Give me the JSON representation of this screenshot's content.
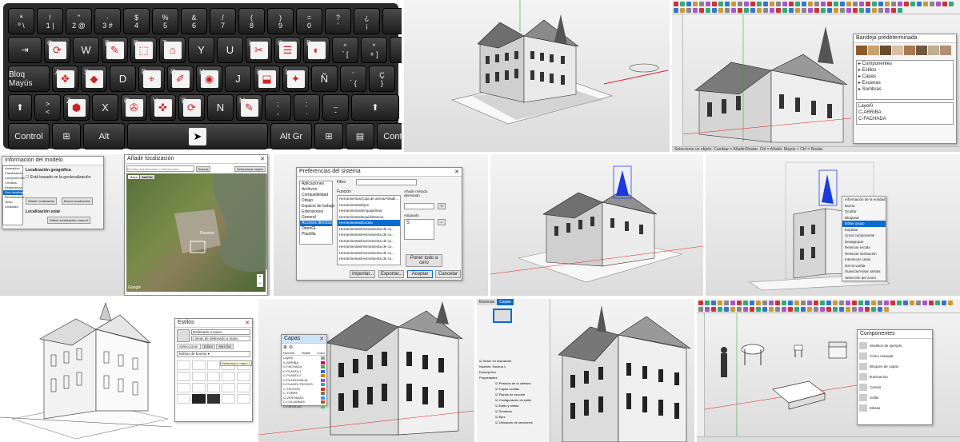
{
  "keyboard": {
    "row1": [
      {
        "top": "ª",
        "bottom": "º \\"
      },
      {
        "top": "!",
        "bottom": "1 |"
      },
      {
        "top": "\"",
        "bottom": "2 @"
      },
      {
        "top": "·",
        "bottom": "3 #"
      },
      {
        "top": "$",
        "bottom": "4"
      },
      {
        "top": "%",
        "bottom": "5"
      },
      {
        "top": "&",
        "bottom": "6"
      },
      {
        "top": "/",
        "bottom": "7"
      },
      {
        "top": "(",
        "bottom": "8"
      },
      {
        "top": ")",
        "bottom": "9"
      },
      {
        "top": "=",
        "bottom": "0"
      },
      {
        "top": "?",
        "bottom": "'"
      },
      {
        "top": "¿",
        "bottom": "¡"
      }
    ],
    "backspace": "←",
    "tab": "⇥",
    "row2_letters": [
      "Q",
      "W",
      "E",
      "R",
      "T",
      "Y",
      "U",
      "I",
      "O",
      "P"
    ],
    "row2_extra": [
      {
        "top": "^",
        "bottom": "` ["
      },
      {
        "top": "*",
        "bottom": "+ ]"
      }
    ],
    "enter": "↵",
    "caps": "Bloq Mayús",
    "row3_letters": [
      "A",
      "S",
      "D",
      "F",
      "G",
      "H",
      "J",
      "K",
      "L",
      "Ñ"
    ],
    "row3_extra": [
      {
        "top": "¨",
        "bottom": "´ {"
      },
      {
        "top": "Ç",
        "bottom": "}"
      }
    ],
    "shift_left": "⬆",
    "angle": {
      "top": ">",
      "bottom": "<"
    },
    "row4_letters": [
      "Z",
      "X",
      "C",
      "V",
      "B",
      "N",
      "M"
    ],
    "row4_extra": [
      {
        "top": ";",
        "bottom": ","
      },
      {
        "top": ":",
        "bottom": "."
      },
      {
        "top": "_",
        "bottom": "-"
      }
    ],
    "shift_right": "⬆",
    "control_left": "Control",
    "alt": "Alt",
    "altgr": "Alt Gr",
    "control_right": "Control"
  },
  "geo_dialog": {
    "title": "Información del modelo",
    "section": "Localización geográfica",
    "checkbox": "Está basado en la geolocalización",
    "side_items": [
      "Animación",
      "Clasificación",
      "Componentes",
      "Créditos",
      "Estadísticas",
      "Geo-localización",
      "Renderización",
      "Texto",
      "Unidades"
    ],
    "selected_side": "Geo-localización",
    "button1": "Añadir localización",
    "button2": "Borrar localización",
    "sun_title": "Localización solar",
    "sun_button": "Definir localización manual"
  },
  "map_window": {
    "title": "Añadir localización",
    "search_placeholder": "Escriba una dirección o intersección",
    "search_button": "Buscar",
    "select_region": "Seleccionar región",
    "tab_map": "Mapa",
    "tab_satellite": "Satélite",
    "city_label": "Rosario",
    "footer": "Google"
  },
  "prefs": {
    "title": "Preferencias del sistema",
    "categories": [
      "Aplicaciones",
      "Archivos",
      "Compatibilidad",
      "Dibujo",
      "Espacio de trabajo",
      "Extensiones",
      "General",
      "OpenGL",
      "Plantilla"
    ],
    "selected_category": "Accesos directos",
    "filter_label": "Filtro",
    "function_label": "Función",
    "functions": [
      "Herramientas/Caja de arena/Añadir...",
      "Herramientas/Ejes",
      "Herramientas/Empujar/tirar",
      "Herramientas/Equidistancia",
      "Herramientas/Escala",
      "Herramientas/Herramienta de co...",
      "Herramientas/Herramienta de co...",
      "Herramientas/Herramienta de co...",
      "Herramientas/Herramienta de co...",
      "Herramientas/Herramienta de co...",
      "Herramientas/Herramienta de co..."
    ],
    "selected_function": "Herramientas/Escala",
    "add_shortcut_label": "Añadir método abreviado",
    "assigned_label": "Asignado",
    "assigned_value": "S",
    "reset_button": "Poner todo a cero",
    "import_button": "Importar...",
    "export_button": "Exportar...",
    "accept_button": "Aceptar",
    "cancel_button": "Cancelar"
  },
  "context_menu": {
    "items": [
      "Información de la entidad",
      "Borrar",
      "Ocultar",
      "Bloquear",
      "Editar grupo",
      "Explotar",
      "Crear componente",
      "Desagrupar",
      "Reiniciar escala",
      "Reiniciar inclinación",
      "Intersecar caras",
      "Dar la vuelta",
      "Suavizar/Alisar aristas",
      "Selección del zoom"
    ],
    "selected": "Editar grupo"
  },
  "styles_panel": {
    "title": "Estilos",
    "style_name": "Delineado a mano",
    "description": "Líneas de delineado a mano",
    "tabs": [
      "Seleccionar",
      "Editar",
      "Mezclar"
    ],
    "dropdown": "Estilos de boceto",
    "tooltip": "Delineado a mano 3"
  },
  "layers_panel": {
    "title": "Capas",
    "header": [
      "Nombre",
      "Visible",
      "Color"
    ],
    "layers": [
      "Layer0",
      "C-ARRIBA",
      "C-FACHADA",
      "C-PLANTA 1",
      "C-PLANTA 2",
      "C-PLANTA BAJA",
      "C-PLANTA TECHOS",
      "C-TECHOS",
      "C-TORRE",
      "C-VENTANAS",
      "C-COLUMNAS",
      "C-FAROLAS"
    ]
  },
  "scenes_panel": {
    "tabs": [
      "Escenas",
      "Capas"
    ],
    "fields": [
      "Incluir en animación",
      "Nombre",
      "Descripción",
      "Propiedades"
    ],
    "name_value": "Escena 1",
    "props": [
      "Posición de la cámara",
      "Capas ocultas",
      "Planos de sección",
      "Configuración de estilo",
      "Estilo y niebla",
      "Sombras",
      "Ejes",
      "Ubicación de secciones"
    ]
  },
  "comp_browser": {
    "title": "Componentes",
    "entries": [
      "Modelos de ejemplo",
      "Cómo manejar",
      "Bloqueo de capas",
      "Iluminación",
      "Camas",
      "Sofás",
      "Mesas"
    ]
  },
  "status_text": "Seleccione un objeto. Cambiar = Añadir/Restar. Ctrl = Añadir. Mayús + Ctrl = Restar.",
  "colors": {
    "accent": "#0b6bcf",
    "red_axis": "#e22222",
    "green_axis": "#22a22a",
    "blue_axis": "#2244ee",
    "keyboard": "#2a2a2a"
  }
}
